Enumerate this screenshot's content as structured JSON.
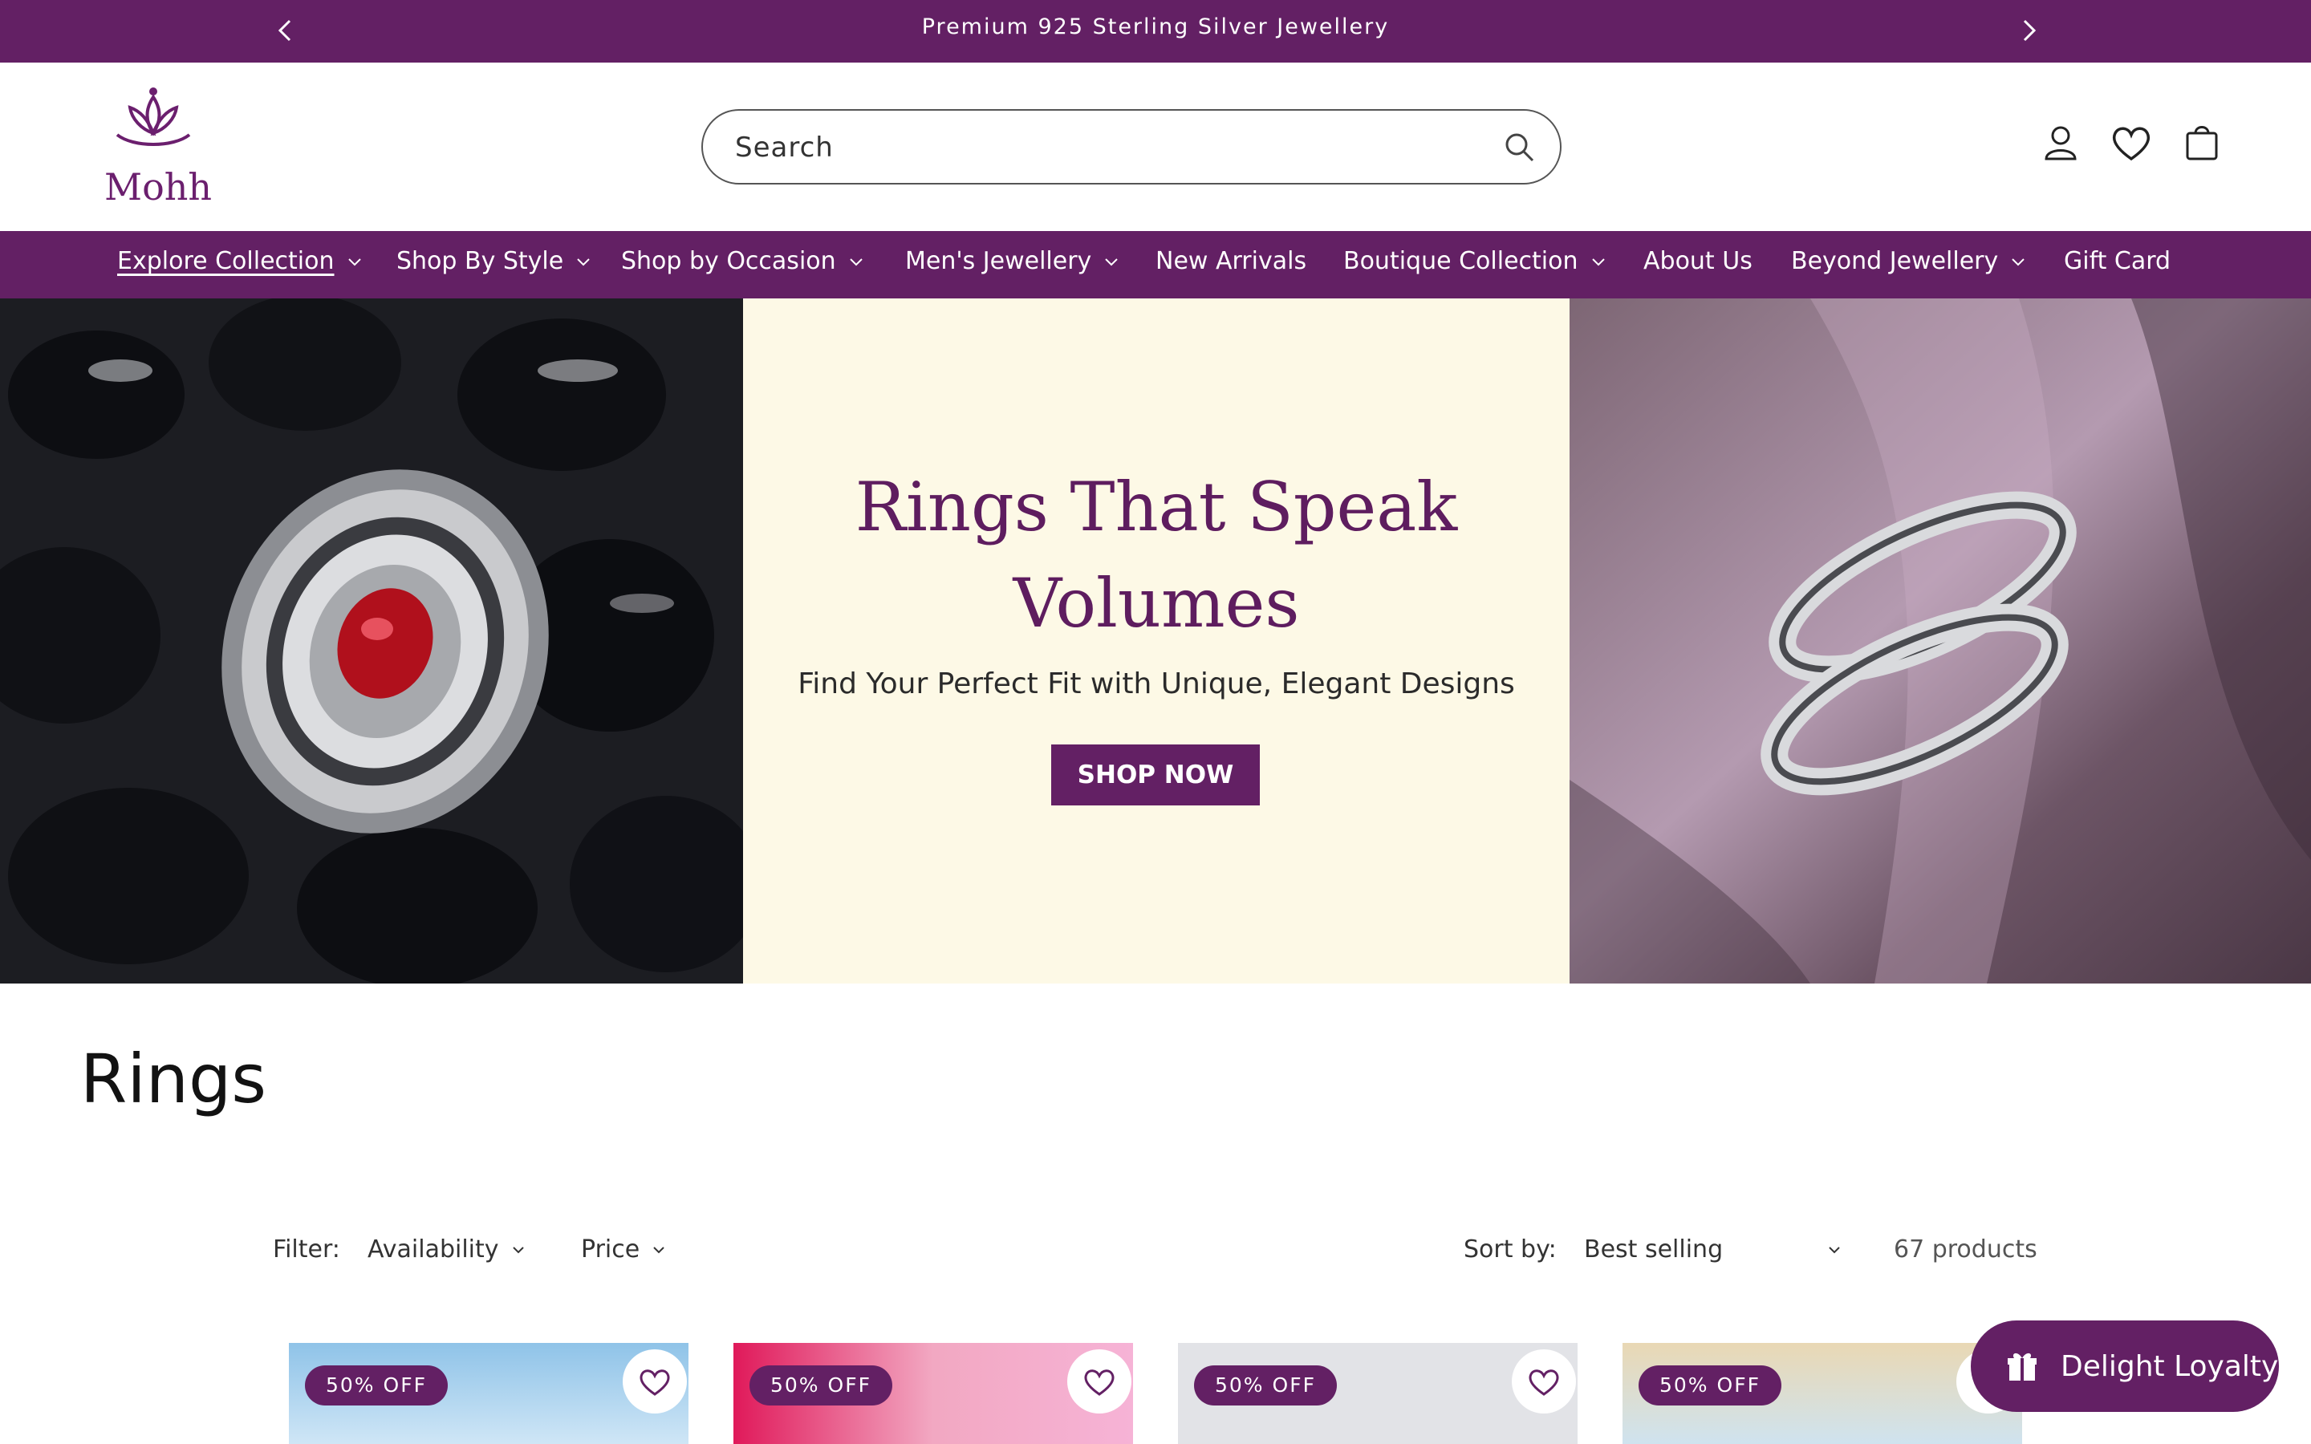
{
  "announcement": {
    "text": "Premium 925 Sterling Silver Jewellery"
  },
  "header": {
    "logo_text": "Mohh",
    "search_placeholder": "Search"
  },
  "nav": {
    "items": [
      {
        "label": "Explore Collection",
        "has_dropdown": true,
        "active": true
      },
      {
        "label": "Shop By Style",
        "has_dropdown": true
      },
      {
        "label": "Shop by Occasion",
        "has_dropdown": true
      },
      {
        "label": "Men's Jewellery",
        "has_dropdown": true
      },
      {
        "label": "New Arrivals",
        "has_dropdown": false
      },
      {
        "label": "Boutique Collection",
        "has_dropdown": true
      },
      {
        "label": "About Us",
        "has_dropdown": false
      },
      {
        "label": "Beyond Jewellery",
        "has_dropdown": true
      },
      {
        "label": "Gift Card",
        "has_dropdown": false
      }
    ]
  },
  "hero": {
    "title_line1": "Rings That Speak",
    "title_line2": "Volumes",
    "subtitle": "Find Your Perfect Fit with Unique, Elegant Designs",
    "cta": "SHOP NOW"
  },
  "collection": {
    "title": "Rings"
  },
  "filters": {
    "filter_label": "Filter:",
    "availability": "Availability",
    "price": "Price",
    "sort_label": "Sort by:",
    "sort_value": "Best selling",
    "product_count": "67 products"
  },
  "products": [
    {
      "badge": "50% OFF"
    },
    {
      "badge": "50% OFF"
    },
    {
      "badge": "50% OFF"
    },
    {
      "badge": "50% OFF"
    }
  ],
  "loyalty": {
    "label": "Delight Loyalty"
  },
  "colors": {
    "brand": "#632064",
    "hero_bg": "#fdf9e6"
  }
}
